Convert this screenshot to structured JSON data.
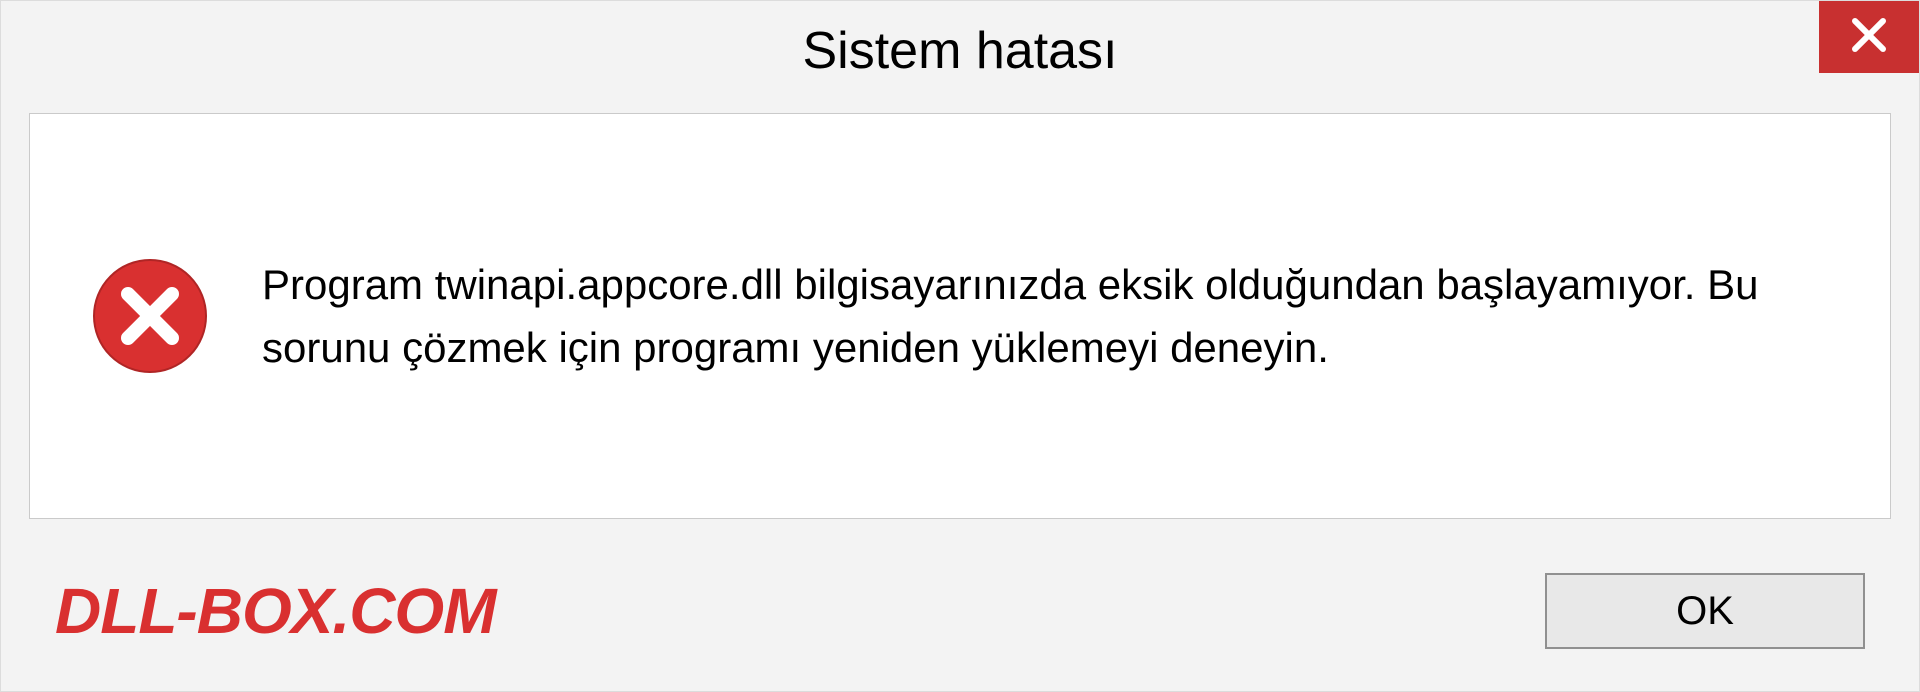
{
  "dialog": {
    "title": "Sistem hatası",
    "message": "Program twinapi.appcore.dll bilgisayarınızda eksik olduğundan başlayamıyor. Bu sorunu çözmek için programı yeniden yüklemeyi deneyin.",
    "ok_label": "OK"
  },
  "watermark": {
    "text": "DLL-BOX.COM"
  },
  "colors": {
    "close_red": "#c83030",
    "error_red": "#d93030",
    "watermark_red": "#d93030"
  }
}
